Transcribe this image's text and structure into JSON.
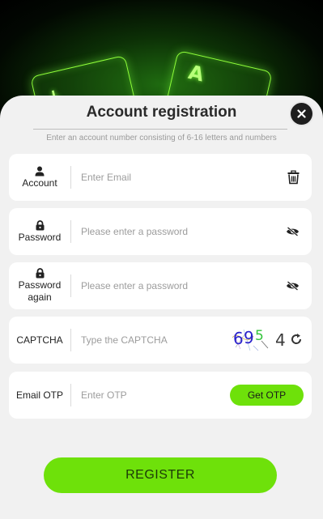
{
  "header": {
    "title": "Account registration",
    "subtitle": "Enter an account number consisting of 6-16 letters and numbers"
  },
  "decor": {
    "left_card_letter": "L",
    "right_card_letter": "A"
  },
  "fields": {
    "account": {
      "label": "Account",
      "placeholder": "Enter Email",
      "value": "",
      "icon": "user-icon",
      "trailing_icon": "trash-icon"
    },
    "password": {
      "label": "Password",
      "placeholder": "Please enter a password",
      "value": "",
      "icon": "lock-icon",
      "trailing_icon": "eye-off-icon"
    },
    "password_again": {
      "label_line1": "Password",
      "label_line2": "again",
      "placeholder": "Please enter a password",
      "value": "",
      "icon": "lock-icon",
      "trailing_icon": "eye-off-icon"
    },
    "captcha": {
      "label": "CAPTCHA",
      "placeholder": "Type the CAPTCHA",
      "value": "",
      "code": [
        "6",
        "9",
        "5",
        "4"
      ],
      "trailing_icon": "refresh-icon"
    },
    "email_otp": {
      "label": "Email OTP",
      "placeholder": "Enter OTP",
      "value": "",
      "button_label": "Get OTP"
    }
  },
  "register_button": {
    "label": "REGISTER"
  },
  "colors": {
    "accent_green": "#6ee10a",
    "panel_bg": "#f1f1f1",
    "close_bg": "#1e1e1e"
  }
}
